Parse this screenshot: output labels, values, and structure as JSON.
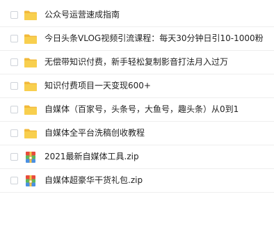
{
  "colors": {
    "folder_yellow": "#f8cf4e",
    "folder_tab": "#f2b93a",
    "zip_red": "#e94b3c",
    "zip_green": "#5cb85c",
    "zip_blue": "#4a90e2",
    "row_divider": "#eeeeee"
  },
  "files": [
    {
      "name": "公众号运营速成指南",
      "icon": "folder-icon",
      "type": "folder"
    },
    {
      "name": "今日头条VLOG视频引流课程：每天30分钟日引10-1000粉",
      "icon": "folder-icon",
      "type": "folder"
    },
    {
      "name": "无偿带知识付费，新手轻松复制影音打法月入过万",
      "icon": "folder-icon",
      "type": "folder"
    },
    {
      "name": "知识付费项目一天变现600+",
      "icon": "folder-icon",
      "type": "folder"
    },
    {
      "name": "自媒体（百家号，头条号，大鱼号，趣头条）从0到1",
      "icon": "folder-icon",
      "type": "folder"
    },
    {
      "name": "自媒体全平台洗稿创收教程",
      "icon": "folder-icon",
      "type": "folder"
    },
    {
      "name": "2021最新自媒体工具.zip",
      "icon": "zip-archive-icon",
      "type": "zip"
    },
    {
      "name": "自媒体超豪华干货礼包.zip",
      "icon": "zip-archive-icon",
      "type": "zip"
    }
  ]
}
